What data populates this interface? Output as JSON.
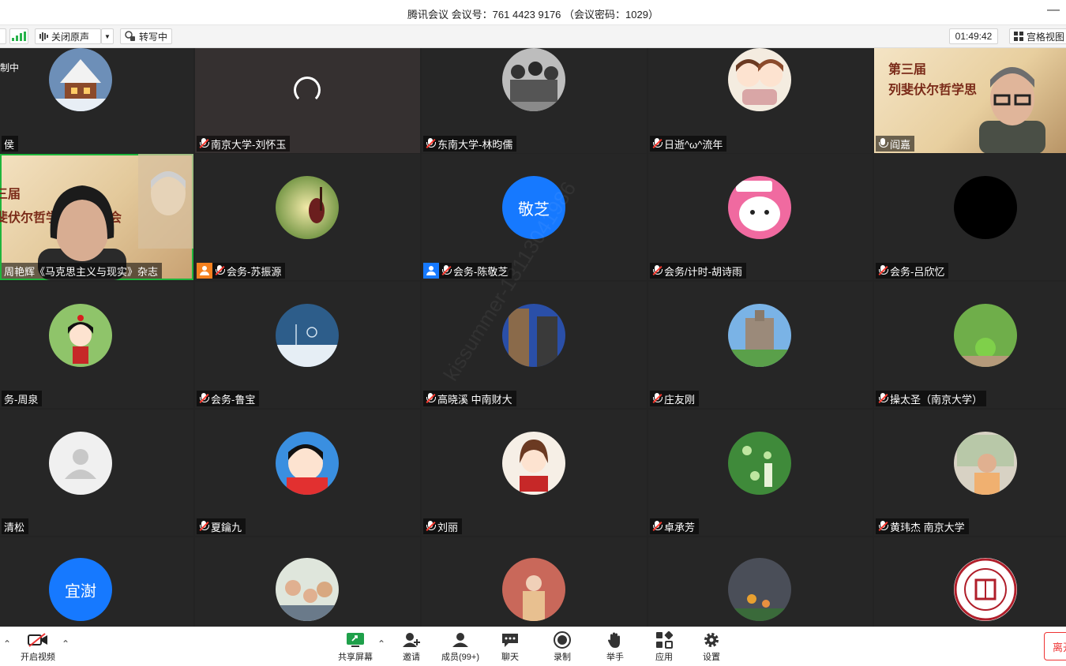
{
  "title": "腾讯会议 会议号：761 4423 9176 （会议密码：1029）",
  "toolbar": {
    "audio_label": "关闭原声",
    "transcribe_label": "转写中",
    "timer": "01:49:42",
    "view_label": "宫格视图"
  },
  "recording_label": "制中",
  "watermark": "kissummer-13113041986",
  "tiles": [
    {
      "name": "侯"
    },
    {
      "name": "南京大学-刘怀玉"
    },
    {
      "name": "东南大学-林昀儒"
    },
    {
      "name": "日逝^ω^流年"
    },
    {
      "name": "阎嘉",
      "banner": "第三届\n列斐伏尔哲学思想研讨会"
    },
    {
      "name": "周艳辉《马克思主义与现实》杂志",
      "banner": "三届\n斐伏尔哲学思想研讨会"
    },
    {
      "name": "会务-苏振源"
    },
    {
      "name": "会务-陈敬芝",
      "avatar_text": "敬芝"
    },
    {
      "name": "会务/计时-胡诗雨"
    },
    {
      "name": "会务-吕欣忆"
    },
    {
      "name": "务-周泉"
    },
    {
      "name": "会务-鲁宝"
    },
    {
      "name": "高晓溪 中南财大"
    },
    {
      "name": "庄友刚"
    },
    {
      "name": "操太圣（南京大学）"
    },
    {
      "name": "清松"
    },
    {
      "name": "夏鑰九"
    },
    {
      "name": "刘丽"
    },
    {
      "name": "卓承芳"
    },
    {
      "name": "黄玮杰 南京大学"
    },
    {
      "name": "",
      "avatar_text": "宜澍"
    },
    {
      "name": ""
    },
    {
      "name": ""
    },
    {
      "name": ""
    },
    {
      "name": "",
      "seal_text": "FUDAN UNIVERSITY 1905"
    }
  ],
  "bottombar": {
    "video": "开启视频",
    "share": "共享屏幕",
    "invite": "邀请",
    "members": "成员(99+)",
    "chat": "聊天",
    "record": "录制",
    "raise_hand": "举手",
    "apps": "应用",
    "settings": "设置",
    "leave": "离开"
  },
  "colors": {
    "accent_blue": "#1679ff",
    "active_speaker": "#1fb53c",
    "muted_red": "#ff3b30",
    "leave_red": "#e33333"
  }
}
